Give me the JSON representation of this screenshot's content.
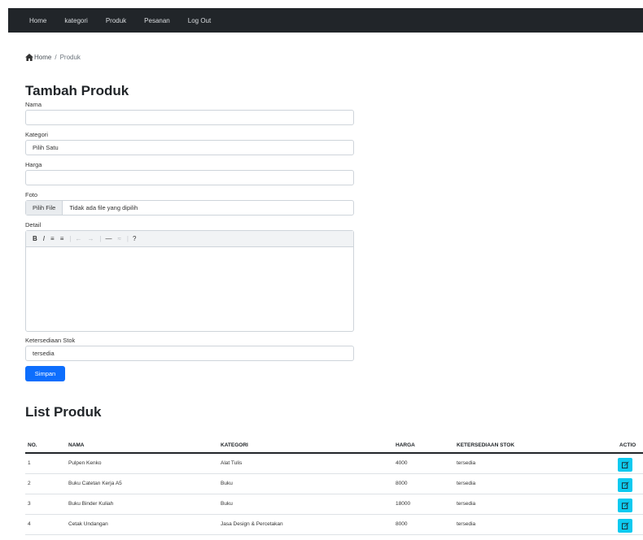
{
  "nav": {
    "items": [
      "Home",
      "kategori",
      "Produk",
      "Pesanan",
      "Log Out"
    ]
  },
  "breadcrumb": {
    "home": "Home",
    "separator": "/",
    "current": "Produk"
  },
  "form": {
    "title": "Tambah Produk",
    "nama": {
      "label": "Nama",
      "value": ""
    },
    "kategori": {
      "label": "Kategori",
      "value": "Pilih Satu"
    },
    "harga": {
      "label": "Harga",
      "value": ""
    },
    "foto": {
      "label": "Foto",
      "button": "Pilih File",
      "status": "Tidak ada file yang dipilih"
    },
    "detail": {
      "label": "Detail",
      "toolbar": [
        "B",
        "I",
        "≡",
        "≡",
        "|",
        "←",
        "→",
        "|",
        "—",
        "≈",
        "|",
        "?"
      ]
    },
    "stok": {
      "label": "Ketersediaan Stok",
      "value": "tersedia"
    },
    "submit": "Simpan"
  },
  "list": {
    "title": "List Produk",
    "columns": [
      "NO.",
      "NAMA",
      "KATEGORI",
      "HARGA",
      "KETERSEDIAAN STOK",
      "ACTIO"
    ],
    "rows": [
      [
        "1",
        "Pulpen Kenko",
        "Alat Tulis",
        "4000",
        "tersedia"
      ],
      [
        "2",
        "Buku Catetan Kerja A5",
        "Buku",
        "8000",
        "tersedia"
      ],
      [
        "3",
        "Buku Binder Kuliah",
        "Buku",
        "18000",
        "tersedia"
      ],
      [
        "4",
        "Cetak Undangan",
        "Jasa Design & Percetakan",
        "8000",
        "tersedia"
      ]
    ]
  },
  "colors": {
    "navbar": "#212529",
    "primary": "#0d6efd",
    "info": "#0dcaf0"
  },
  "icons": {
    "home": "home-icon",
    "edit": "edit-icon"
  }
}
